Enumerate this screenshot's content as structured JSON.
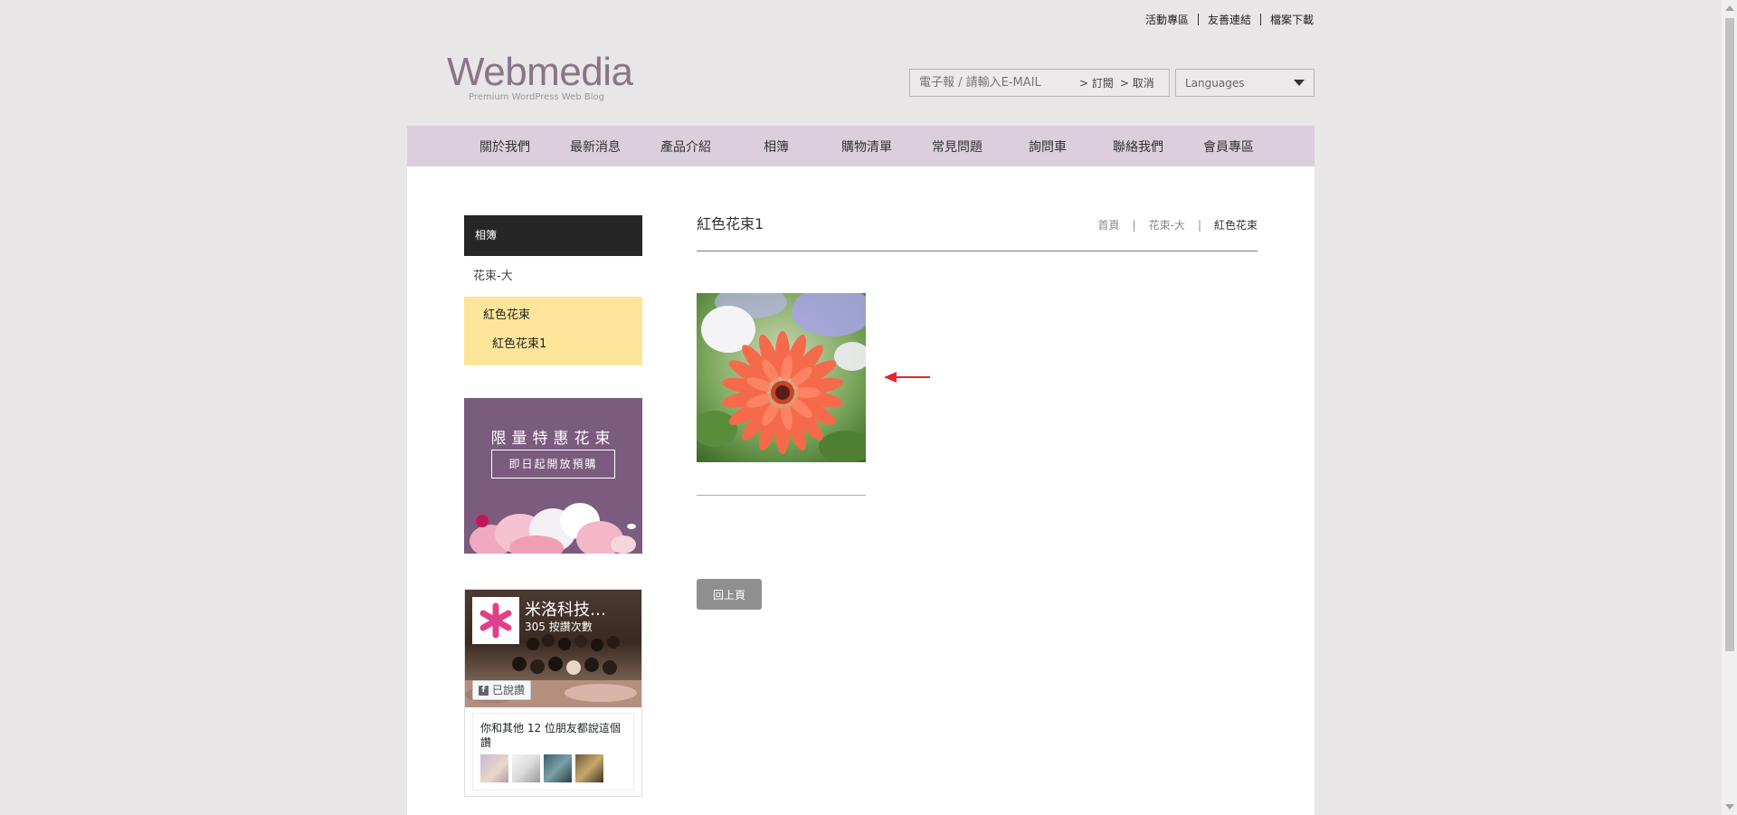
{
  "top_links": [
    "活動專區",
    "友善連結",
    "檔案下載"
  ],
  "logo": {
    "brand": "Webmedia",
    "tagline": "Premium WordPress Web Blog"
  },
  "subscribe": {
    "placeholder": "電子報 / 請輸入E-MAIL",
    "subscribe_label": "> 訂閱",
    "cancel_label": "> 取消"
  },
  "language": {
    "selected": "Languages"
  },
  "nav": [
    "關於我們",
    "最新消息",
    "產品介紹",
    "相簿",
    "購物清單",
    "常見問題",
    "詢問車",
    "聯絡我們",
    "會員專區"
  ],
  "sidebar": {
    "heading": "相簿",
    "level1": "花束-大",
    "level2": "紅色花束",
    "level3": "紅色花束1"
  },
  "promo": {
    "title": "限量特惠花束",
    "subtitle": "即日起開放預購"
  },
  "facebook": {
    "page_name": "米洛科技…",
    "likes": "305 按讚次數",
    "liked_button": "已說讚",
    "friends_text": "你和其他 12 位朋友都說這個讚"
  },
  "main": {
    "title": "紅色花束1",
    "breadcrumb": [
      "首頁",
      "花束-大",
      "紅色花束"
    ],
    "back_button": "回上頁"
  },
  "colors": {
    "nav_bg": "#dccfdb",
    "brand": "#8b7488",
    "highlight": "#fde59a",
    "sidebar_head": "#262626",
    "promo_bg": "#7b5b7e",
    "arrow": "#e0262b"
  }
}
